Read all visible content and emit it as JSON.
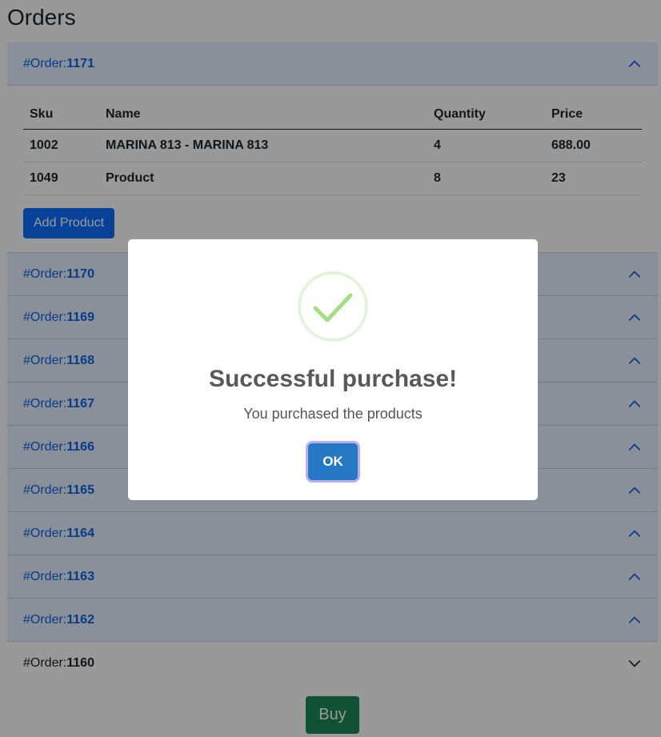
{
  "page": {
    "title": "Orders"
  },
  "orders": [
    {
      "prefix": "#Order:",
      "number": "1171",
      "expanded": true
    },
    {
      "prefix": "#Order:",
      "number": "1170",
      "expanded": false
    },
    {
      "prefix": "#Order:",
      "number": "1169",
      "expanded": false
    },
    {
      "prefix": "#Order:",
      "number": "1168",
      "expanded": false
    },
    {
      "prefix": "#Order:",
      "number": "1167",
      "expanded": false
    },
    {
      "prefix": "#Order:",
      "number": "1166",
      "expanded": false
    },
    {
      "prefix": "#Order:",
      "number": "1165",
      "expanded": false
    },
    {
      "prefix": "#Order:",
      "number": "1164",
      "expanded": false
    },
    {
      "prefix": "#Order:",
      "number": "1163",
      "expanded": false
    },
    {
      "prefix": "#Order:",
      "number": "1162",
      "expanded": false
    },
    {
      "prefix": "#Order:",
      "number": "1160",
      "expanded": false
    }
  ],
  "table": {
    "headers": [
      "Sku",
      "Name",
      "Quantity",
      "Price"
    ],
    "rows": [
      [
        "1002",
        "MARINA 813 - MARINA 813",
        "4",
        "688.00"
      ],
      [
        "1049",
        "Product",
        "8",
        "23"
      ]
    ]
  },
  "buttons": {
    "add_product": "Add Product",
    "buy": "Buy"
  },
  "modal": {
    "title": "Successful purchase!",
    "text": "You purchased the products",
    "ok": "OK",
    "icon": "success-check-icon"
  },
  "colors": {
    "accent": "#0c63e4",
    "open_header_bg": "#e7f1ff",
    "primary_button": "#0d6efd",
    "buy_button": "#198754",
    "ok_button": "#2778c4",
    "check": "#a5dc86"
  }
}
